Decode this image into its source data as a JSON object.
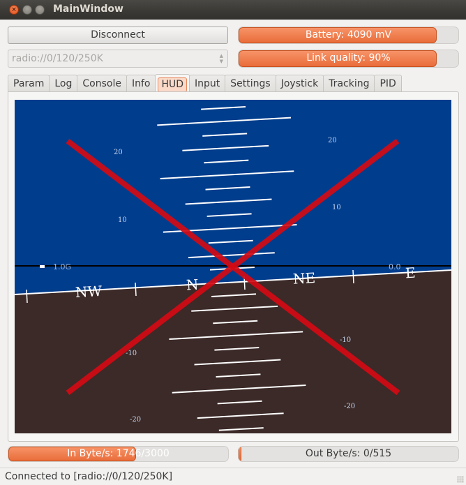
{
  "window": {
    "title": "MainWindow",
    "controls": {
      "close": "×",
      "minimize": "–",
      "maximize": "□"
    }
  },
  "connection": {
    "disconnect_label": "Disconnect",
    "uri_value": "radio://0/120/250K",
    "uri_arrows": "▴\n▾"
  },
  "battery": {
    "label": "Battery: 4090 mV",
    "fraction": 0.9
  },
  "link_quality": {
    "label": "Link quality: 90%",
    "fraction": 0.9
  },
  "tabs": [
    {
      "label": "Param",
      "active": false
    },
    {
      "label": "Log",
      "active": false
    },
    {
      "label": "Console",
      "active": false
    },
    {
      "label": "Info",
      "active": false
    },
    {
      "label": "HUD",
      "active": true
    },
    {
      "label": "Input",
      "active": false
    },
    {
      "label": "Settings",
      "active": false
    },
    {
      "label": "Joystick",
      "active": false
    },
    {
      "label": "Tracking",
      "active": false
    },
    {
      "label": "PID",
      "active": false
    }
  ],
  "hud": {
    "colors": {
      "sky": "#003d8d",
      "ground": "#3b2a28",
      "cross": "#d40a14",
      "lines": "#ffffff",
      "labels": "#c8d6ee"
    },
    "roll_deg": -3.2,
    "pitch_labels_left": [
      "20",
      "10",
      "-10",
      "-20"
    ],
    "pitch_labels_right": [
      "20",
      "10",
      "-10",
      "-20"
    ],
    "compass": [
      "NW",
      "N",
      "NE",
      "E"
    ],
    "g_label": "1.0G",
    "alt_label": "0.0",
    "disconnected_overlay": true
  },
  "in_bytes": {
    "label": "In Byte/s: 1746/3000",
    "fraction": 0.582
  },
  "out_bytes": {
    "label": "Out Byte/s: 0/515",
    "fraction": 0.0
  },
  "status_bar": {
    "text": "Connected to [radio://0/120/250K]"
  }
}
